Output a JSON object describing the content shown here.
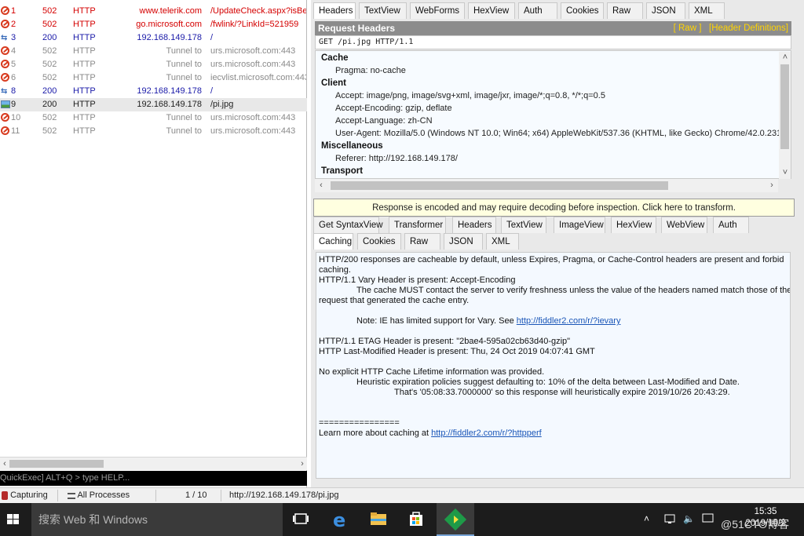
{
  "sessions": [
    {
      "num": "1",
      "result": "502",
      "protocol": "HTTP",
      "host": "www.telerik.com",
      "url": "/UpdateCheck.aspx?isBet",
      "icon": "blocked-icon",
      "style": "err"
    },
    {
      "num": "2",
      "result": "502",
      "protocol": "HTTP",
      "host": "go.microsoft.com",
      "url": "/fwlink/?LinkId=521959",
      "icon": "blocked-icon",
      "style": "err"
    },
    {
      "num": "3",
      "result": "200",
      "protocol": "HTTP",
      "host": "192.168.149.178",
      "url": "/",
      "icon": "arrows-icon",
      "style": "blue"
    },
    {
      "num": "4",
      "result": "502",
      "protocol": "HTTP",
      "host": "Tunnel to",
      "url": "urs.microsoft.com:443",
      "icon": "blocked-icon",
      "style": "grey"
    },
    {
      "num": "5",
      "result": "502",
      "protocol": "HTTP",
      "host": "Tunnel to",
      "url": "urs.microsoft.com:443",
      "icon": "blocked-icon",
      "style": "grey"
    },
    {
      "num": "6",
      "result": "502",
      "protocol": "HTTP",
      "host": "Tunnel to",
      "url": "iecvlist.microsoft.com:443",
      "icon": "blocked-icon",
      "style": "grey"
    },
    {
      "num": "8",
      "result": "200",
      "protocol": "HTTP",
      "host": "192.168.149.178",
      "url": "/",
      "icon": "arrows-icon",
      "style": "blue"
    },
    {
      "num": "9",
      "result": "200",
      "protocol": "HTTP",
      "host": "192.168.149.178",
      "url": "/pi.jpg",
      "icon": "image-icon",
      "style": "dark",
      "selected": true
    },
    {
      "num": "10",
      "result": "502",
      "protocol": "HTTP",
      "host": "Tunnel to",
      "url": "urs.microsoft.com:443",
      "icon": "blocked-icon",
      "style": "grey"
    },
    {
      "num": "11",
      "result": "502",
      "protocol": "HTTP",
      "host": "Tunnel to",
      "url": "urs.microsoft.com:443",
      "icon": "blocked-icon",
      "style": "grey"
    }
  ],
  "quickexec": "QuickExec] ALT+Q > type HELP...",
  "request_tabs": [
    {
      "label": "Headers",
      "active": true
    },
    {
      "label": "TextView"
    },
    {
      "label": "WebForms"
    },
    {
      "label": "HexView"
    },
    {
      "label": "Auth"
    },
    {
      "label": "Cookies"
    },
    {
      "label": "Raw"
    },
    {
      "label": "JSON"
    },
    {
      "label": "XML"
    }
  ],
  "request_headers": {
    "title": "Request Headers",
    "raw_link": "[ Raw ]",
    "defs_link": "[Header Definitions]",
    "request_line": "GET /pi.jpg HTTP/1.1",
    "groups": [
      {
        "name": "Cache",
        "items": [
          "Pragma: no-cache"
        ]
      },
      {
        "name": "Client",
        "items": [
          "Accept: image/png, image/svg+xml, image/jxr, image/*;q=0.8, */*;q=0.5",
          "Accept-Encoding: gzip, deflate",
          "Accept-Language: zh-CN",
          "User-Agent: Mozilla/5.0 (Windows NT 10.0; Win64; x64) AppleWebKit/537.36 (KHTML, like Gecko) Chrome/42.0.2311"
        ]
      },
      {
        "name": "Miscellaneous",
        "items": [
          "Referer: http://192.168.149.178/"
        ]
      },
      {
        "name": "Transport",
        "items": []
      }
    ]
  },
  "encoded_notice": "Response is encoded and may require decoding before inspection. Click here to transform.",
  "response_tabs_row1": [
    {
      "label": "Get SyntaxView"
    },
    {
      "label": "Transformer"
    },
    {
      "label": "Headers"
    },
    {
      "label": "TextView"
    },
    {
      "label": "ImageView"
    },
    {
      "label": "HexView"
    },
    {
      "label": "WebView"
    },
    {
      "label": "Auth"
    }
  ],
  "response_tabs_row2": [
    {
      "label": "Caching",
      "active": true
    },
    {
      "label": "Cookies"
    },
    {
      "label": "Raw"
    },
    {
      "label": "JSON"
    },
    {
      "label": "XML"
    }
  ],
  "caching": {
    "l1": "HTTP/200 responses are cacheable by default, unless Expires, Pragma, or Cache-Control headers are present and forbid",
    "l2": "caching.",
    "l3": "HTTP/1.1 Vary Header is present: Accept-Encoding",
    "l4": "The cache MUST contact the server to verify freshness unless the value of the headers named match those of the",
    "l5": "request that generated the cache entry.",
    "l6_text": "Note: IE has limited support for Vary.  See ",
    "l6_link": "http://fiddler2.com/r/?ievary",
    "l7": "HTTP/1.1 ETAG Header is present: \"2bae4-595a02cb63d40-gzip\"",
    "l8": "HTTP Last-Modified Header is present: Thu, 24 Oct 2019 04:07:41 GMT",
    "l9": "No explicit HTTP Cache Lifetime information was provided.",
    "l10": "Heuristic expiration policies suggest defaulting to: 10% of the delta between Last-Modified and Date.",
    "l11": "That's '05:08:33.7000000' so this response will heuristically expire 2019/10/26 20:43:29.",
    "l12": "================",
    "l13_text": "Learn more about caching at ",
    "l13_link": "http://fiddler2.com/r/?httpperf"
  },
  "statusbar": {
    "capturing": "Capturing",
    "processes": "All Processes",
    "count": "1 / 10",
    "url": "http://192.168.149.178/pi.jpg"
  },
  "taskbar": {
    "search_placeholder": "搜索 Web 和 Windows",
    "time": "15:35",
    "date": "2019/10/2",
    "watermark": "@51CTO博客"
  },
  "colors": {
    "error": "#d40000",
    "host_blue": "#1a1aa8",
    "tunnel_grey": "#8a8a8a",
    "header_bar": "#8c8c8c",
    "header_links": "#ffd400",
    "notice_bg": "#ffffe0",
    "link": "#1a56b8"
  }
}
